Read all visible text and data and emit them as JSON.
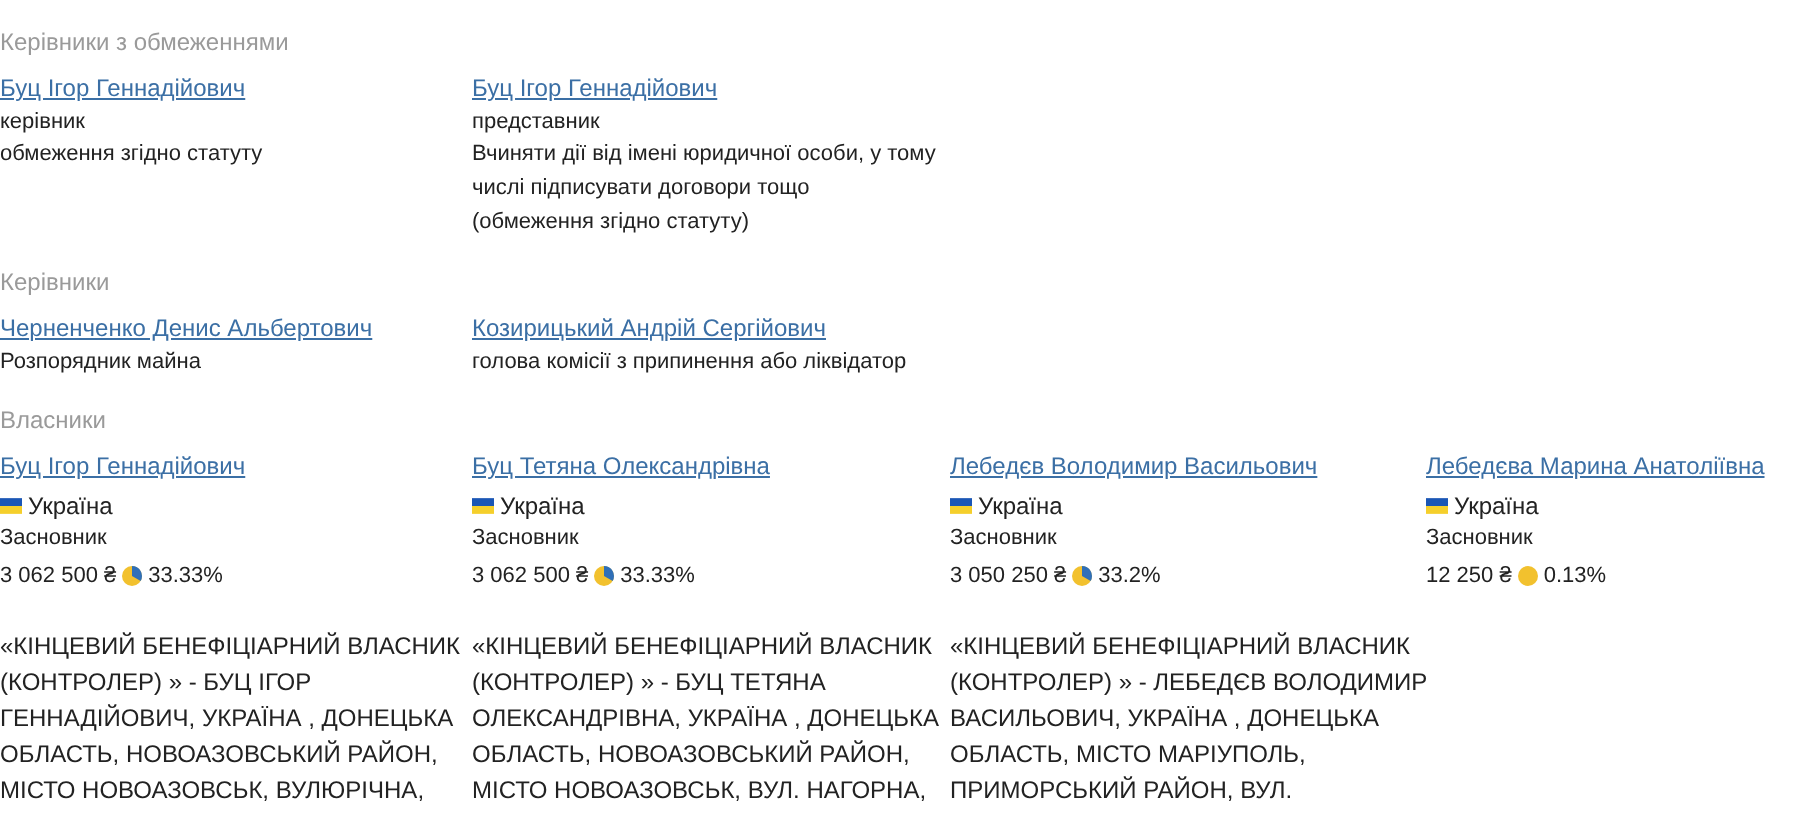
{
  "sections": [
    {
      "title": "Керівники з обмеженнями",
      "kind": "managers",
      "people": [
        {
          "name": "Буц Ігор Геннадійович",
          "role": "керівник",
          "note": "обмеження згідно статуту"
        },
        {
          "name": "Буц Ігор Геннадійович",
          "role": "представник",
          "note": "Вчиняти дії від імені юридичної особи, у тому числі підписувати договори тощо (обмеження згідно статуту)"
        }
      ]
    },
    {
      "title": "Керівники",
      "kind": "managers",
      "people": [
        {
          "name": "Черненченко Денис Альбертович",
          "role": "Розпорядник майна"
        },
        {
          "name": "Козирицький Андрій Сергійович",
          "role": "голова комісії з припинення або ліквідатор"
        }
      ]
    },
    {
      "title": "Власники",
      "kind": "owners",
      "people": [
        {
          "name": "Буц Ігор Геннадійович",
          "country": "Україна",
          "role": "Засновник",
          "amount": "3 062 500 ₴",
          "share": "33.33%",
          "kind": "slice",
          "description": [
            "«КІНЦЕВИЙ БЕНЕФІЦІАРНИЙ ВЛАСНИК",
            "(КОНТРОЛЕР) » - БУЦ ІГОР",
            "ГЕННАДІЙОВИЧ, УКРАЇНА , ДОНЕЦЬКА",
            "ОБЛАСТЬ, НОВОАЗОВСЬКИЙ РАЙОН,",
            "МІСТО НОВОАЗОВСЬК, ВУЛЮРІЧНА,"
          ]
        },
        {
          "name": "Буц Тетяна Олександрівна",
          "country": "Україна",
          "role": "Засновник",
          "amount": "3 062 500 ₴",
          "share": "33.33%",
          "kind": "slice",
          "description": [
            "«КІНЦЕВИЙ БЕНЕФІЦІАРНИЙ ВЛАСНИК",
            "(КОНТРОЛЕР) » - БУЦ ТЕТЯНА",
            "ОЛЕКСАНДРІВНА, УКРАЇНА , ДОНЕЦЬКА",
            "ОБЛАСТЬ, НОВОАЗОВСЬКИЙ РАЙОН,",
            "МІСТО НОВОАЗОВСЬК, ВУЛ. НАГОРНА,"
          ]
        },
        {
          "name": "Лебедєв Володимир Васильович",
          "country": "Україна",
          "role": "Засновник",
          "amount": "3 050 250 ₴",
          "share": "33.2%",
          "kind": "slice",
          "description": [
            "«КІНЦЕВИЙ БЕНЕФІЦІАРНИЙ ВЛАСНИК",
            "(КОНТРОЛЕР) » - ЛЕБЕДЄВ ВОЛОДИМИР",
            "ВАСИЛЬОВИЧ, УКРАЇНА , ДОНЕЦЬКА",
            "ОБЛАСТЬ, МІСТО МАРІУПОЛЬ,",
            "ПРИМОРСЬКИЙ РАЙОН, ВУЛ."
          ]
        },
        {
          "name": "Лебедєва Марина Анатоліївна",
          "country": "Україна",
          "role": "Засновник",
          "amount": "12 250 ₴",
          "share": "0.13%",
          "kind": "dot"
        }
      ]
    }
  ]
}
